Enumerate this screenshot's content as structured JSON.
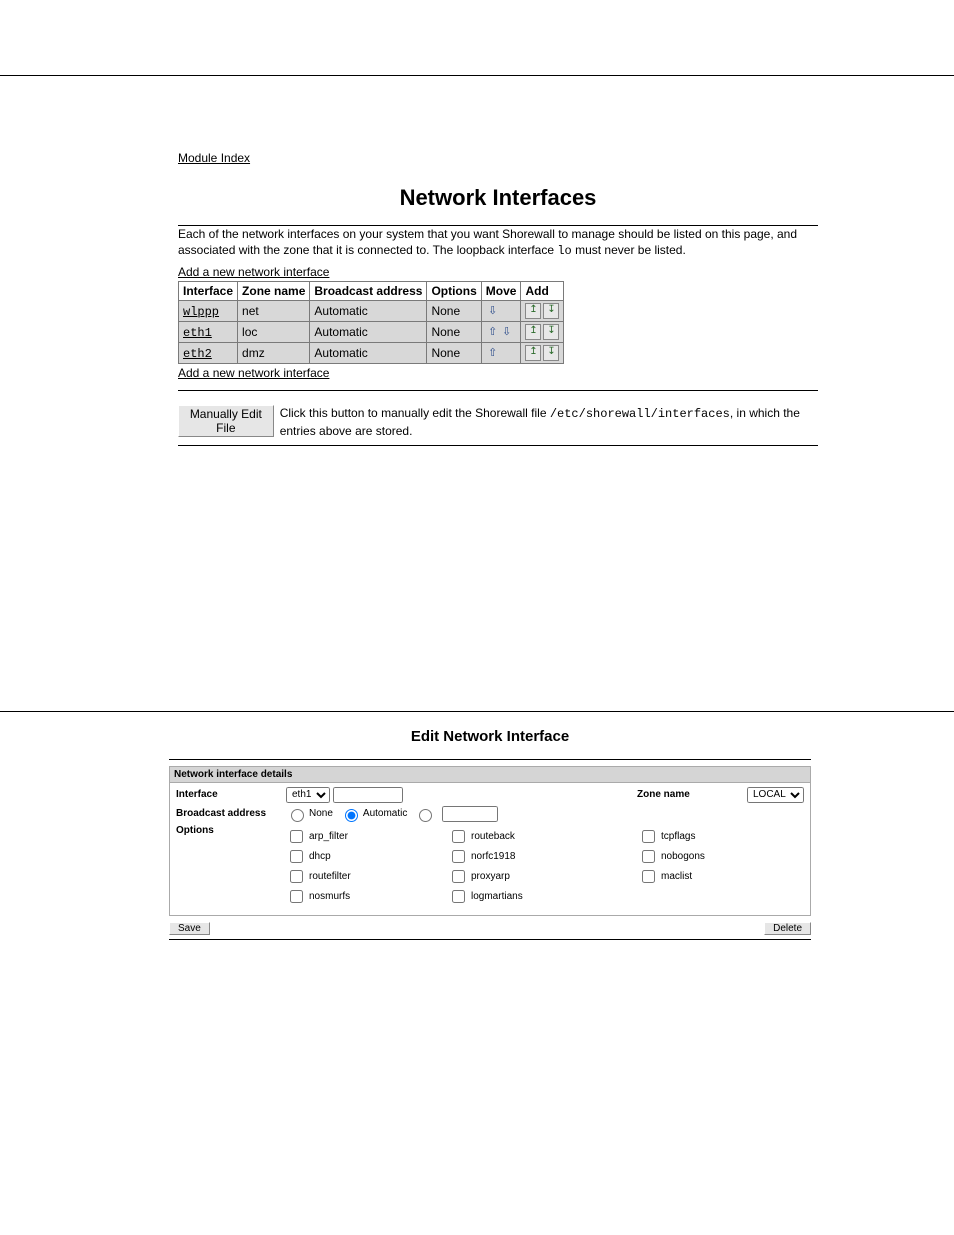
{
  "panel1": {
    "module_index": "Module Index",
    "title": "Network Interfaces",
    "desc_pre": "Each of the network interfaces on your system that you want Shorewall to manage should be listed on this page, and associated with the zone that it is connected to. The loopback interface ",
    "desc_mono": "lo",
    "desc_post": " must never be listed.",
    "add_link": "Add a new network interface",
    "headers": {
      "iface": "Interface",
      "zone": "Zone name",
      "bcast": "Broadcast address",
      "opts": "Options",
      "move": "Move",
      "add": "Add"
    },
    "rows": [
      {
        "iface": "wlppp",
        "zone": "net",
        "bcast": "Automatic",
        "opts": "None",
        "up": false,
        "down": true
      },
      {
        "iface": "eth1",
        "zone": "loc",
        "bcast": "Automatic",
        "opts": "None",
        "up": true,
        "down": true
      },
      {
        "iface": "eth2",
        "zone": "dmz",
        "bcast": "Automatic",
        "opts": "None",
        "up": true,
        "down": false
      }
    ],
    "manual_btn": "Manually Edit File",
    "manual_text_pre": "Click this button to manually edit the Shorewall file ",
    "manual_text_mono": "/etc/shorewall/interfaces",
    "manual_text_post": ", in which the entries above are stored."
  },
  "panel2": {
    "title": "Edit Network Interface",
    "section": "Network interface details",
    "labels": {
      "iface": "Interface",
      "zone": "Zone name",
      "bcast": "Broadcast address",
      "opts": "Options"
    },
    "iface_select": "eth1",
    "zone_select": "LOCAL",
    "bcast": {
      "none": "None",
      "auto": "Automatic",
      "selected": "auto"
    },
    "options": {
      "col1": [
        "arp_filter",
        "dhcp",
        "routefilter",
        "nosmurfs"
      ],
      "col2": [
        "routeback",
        "norfc1918",
        "proxyarp",
        "logmartians"
      ],
      "col3": [
        "tcpflags",
        "nobogons",
        "maclist"
      ]
    },
    "save_btn": "Save",
    "delete_btn": "Delete"
  }
}
